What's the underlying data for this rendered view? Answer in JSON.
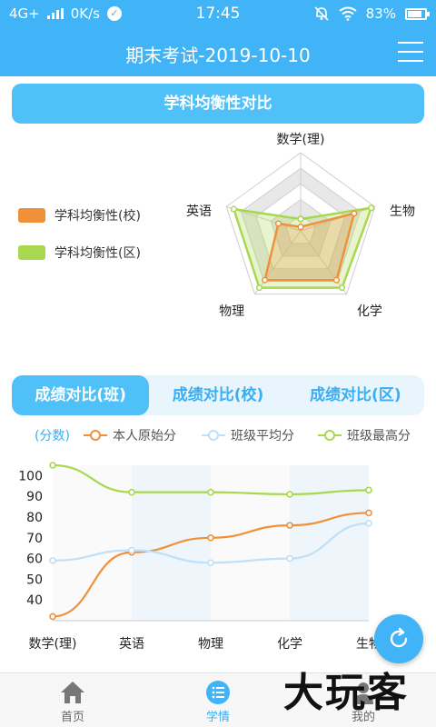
{
  "status_bar": {
    "network": "4G+",
    "speed": "0K/s",
    "time": "17:45",
    "battery": "83%"
  },
  "header": {
    "title": "期末考试-2019-10-10"
  },
  "radar_section": {
    "title": "学科均衡性对比",
    "legend": [
      {
        "label": "学科均衡性(校)",
        "color": "#f0913a"
      },
      {
        "label": "学科均衡性(区)",
        "color": "#a8d84f"
      }
    ]
  },
  "chart_data": [
    {
      "type": "radar",
      "axes": [
        "数学(理)",
        "生物",
        "化学",
        "物理",
        "英语"
      ],
      "series": [
        {
          "name": "学科均衡性(校)",
          "values": [
            0.05,
            0.72,
            0.78,
            0.78,
            0.3
          ]
        },
        {
          "name": "学科均衡性(区)",
          "values": [
            0.15,
            0.95,
            0.9,
            0.9,
            0.9
          ]
        }
      ],
      "rings": 5
    },
    {
      "type": "line",
      "categories": [
        "数学(理)",
        "英语",
        "物理",
        "化学",
        "生物"
      ],
      "ylim": [
        30,
        105
      ],
      "yticks": [
        40,
        50,
        60,
        70,
        80,
        90,
        100
      ],
      "series": [
        {
          "name": "本人原始分",
          "color": "#f0913a",
          "values": [
            32,
            63,
            70,
            76,
            82
          ]
        },
        {
          "name": "班级平均分",
          "color": "#bfe0f7",
          "values": [
            59,
            64,
            58,
            60,
            77
          ]
        },
        {
          "name": "班级最高分",
          "color": "#a8d84f",
          "values": [
            105,
            92,
            92,
            91,
            93
          ]
        }
      ]
    }
  ],
  "tabs": [
    {
      "label": "成绩对比(班)",
      "active": true
    },
    {
      "label": "成绩对比(校)",
      "active": false
    },
    {
      "label": "成绩对比(区)",
      "active": false
    }
  ],
  "line_legend": {
    "unit": "(分数)"
  },
  "bottom_nav": [
    {
      "label": "首页",
      "icon": "home-icon",
      "active": false
    },
    {
      "label": "学情",
      "icon": "list-icon",
      "active": true
    },
    {
      "label": "我的",
      "icon": "user-icon",
      "active": false
    }
  ],
  "watermark": "大玩客"
}
